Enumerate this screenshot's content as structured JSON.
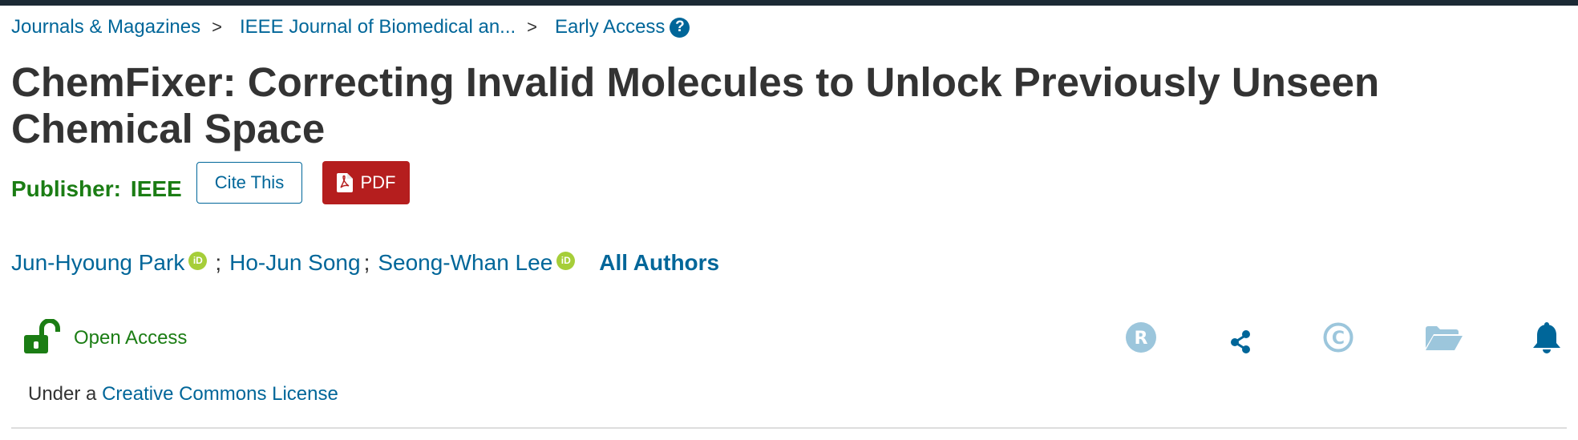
{
  "breadcrumb": {
    "items": [
      "Journals & Magazines",
      "IEEE Journal of Biomedical an...",
      "Early Access"
    ],
    "separator": ">",
    "help_icon": "question-circle-icon"
  },
  "article": {
    "title": "ChemFixer: Correcting Invalid Molecules to Unlock Previously Unseen Chemical Space",
    "publisher_label": "Publisher:",
    "publisher_name": "IEEE"
  },
  "actions": {
    "cite_label": "Cite This",
    "pdf_label": "PDF"
  },
  "authors": {
    "list": [
      "Jun-Hyoung Park",
      "Ho-Jun Song",
      "Seong-Whan Lee"
    ],
    "separator": ";",
    "all_authors_label": "All Authors",
    "orcid_label": "iD"
  },
  "access": {
    "open_access_label": "Open Access",
    "license_prefix": "Under a",
    "license_link": "Creative Commons License"
  },
  "toolbar": {
    "icons": [
      "rights-permissions-icon",
      "share-icon",
      "copyright-icon",
      "folder-icon",
      "bell-icon"
    ],
    "rights_letter": "R",
    "copyright_letter": "C"
  },
  "colors": {
    "link": "#006699",
    "publisher_green": "#1b7d14",
    "pdf_red": "#b51e1e",
    "orcid_green": "#a6ce39",
    "icon_disabled": "#9cc6dc",
    "top_bar": "#1c2a35"
  }
}
